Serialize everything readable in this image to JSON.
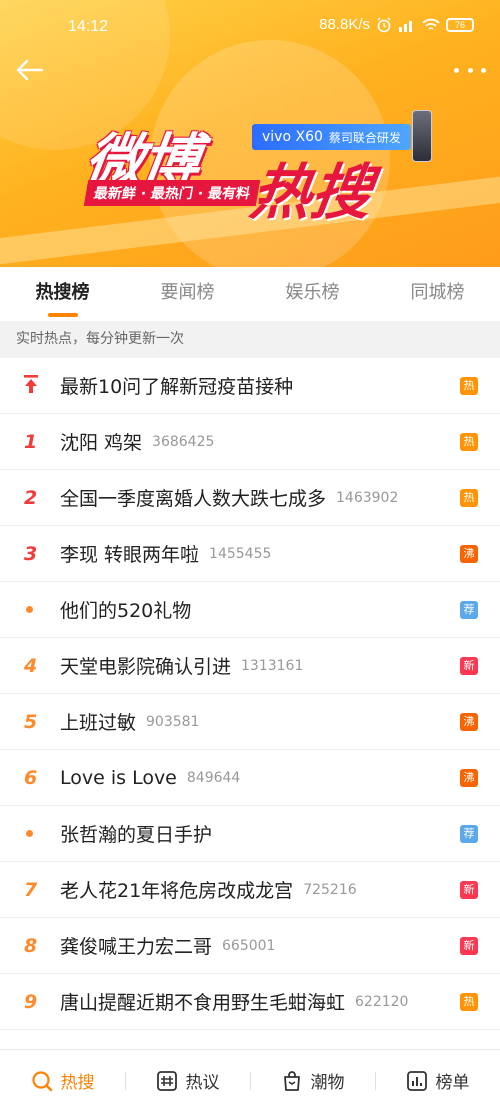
{
  "status": {
    "time": "14:12",
    "speed": "88.8K/s",
    "battery": "76"
  },
  "banner": {
    "logo_main": "微博",
    "logo_hot": "热搜",
    "tagline": "最新鲜 · 最热门 · 最有料",
    "sponsor_brand": "vivo X60",
    "sponsor_text": "蔡司联合研发"
  },
  "tabs": [
    {
      "label": "热搜榜"
    },
    {
      "label": "要闻榜"
    },
    {
      "label": "娱乐榜"
    },
    {
      "label": "同城榜"
    }
  ],
  "subhead": "实时热点，每分钟更新一次",
  "list": [
    {
      "rank": "",
      "title": "最新10问了解新冠疫苗接种",
      "count": "",
      "tag": "热",
      "tag_color": "#ff9406"
    },
    {
      "rank": "1",
      "title": "沈阳 鸡架",
      "count": "3686425",
      "tag": "热",
      "tag_color": "#ff9406"
    },
    {
      "rank": "2",
      "title": "全国一季度离婚人数大跌七成多",
      "count": "1463902",
      "tag": "热",
      "tag_color": "#ff9406"
    },
    {
      "rank": "3",
      "title": "李现 转眼两年啦",
      "count": "1455455",
      "tag": "沸",
      "tag_color": "#f86400"
    },
    {
      "rank": "",
      "title": "他们的520礼物",
      "count": "",
      "tag": "荐",
      "tag_color": "#5ba8ea"
    },
    {
      "rank": "4",
      "title": "天堂电影院确认引进",
      "count": "1313161",
      "tag": "新",
      "tag_color": "#ff3852"
    },
    {
      "rank": "5",
      "title": "上班过敏",
      "count": "903581",
      "tag": "沸",
      "tag_color": "#f86400"
    },
    {
      "rank": "6",
      "title": "Love is Love",
      "count": "849644",
      "tag": "沸",
      "tag_color": "#f86400"
    },
    {
      "rank": "",
      "title": "张哲瀚的夏日手护",
      "count": "",
      "tag": "荐",
      "tag_color": "#5ba8ea"
    },
    {
      "rank": "7",
      "title": "老人花21年将危房改成龙宫",
      "count": "725216",
      "tag": "新",
      "tag_color": "#ff3852"
    },
    {
      "rank": "8",
      "title": "龚俊喊王力宏二哥",
      "count": "665001",
      "tag": "新",
      "tag_color": "#ff3852"
    },
    {
      "rank": "9",
      "title": "唐山提醒近期不食用野生毛蚶海虹",
      "count": "622120",
      "tag": "热",
      "tag_color": "#ff9406"
    }
  ],
  "bottom_nav": [
    {
      "label": "热搜",
      "icon": "search-icon"
    },
    {
      "label": "热议",
      "icon": "hashtag-icon"
    },
    {
      "label": "潮物",
      "icon": "bag-icon"
    },
    {
      "label": "榜单",
      "icon": "chart-icon"
    }
  ],
  "colors": {
    "accent": "#ff8200",
    "top_rank": "#f43b3b",
    "mid_rank": "#ff8a2b"
  }
}
